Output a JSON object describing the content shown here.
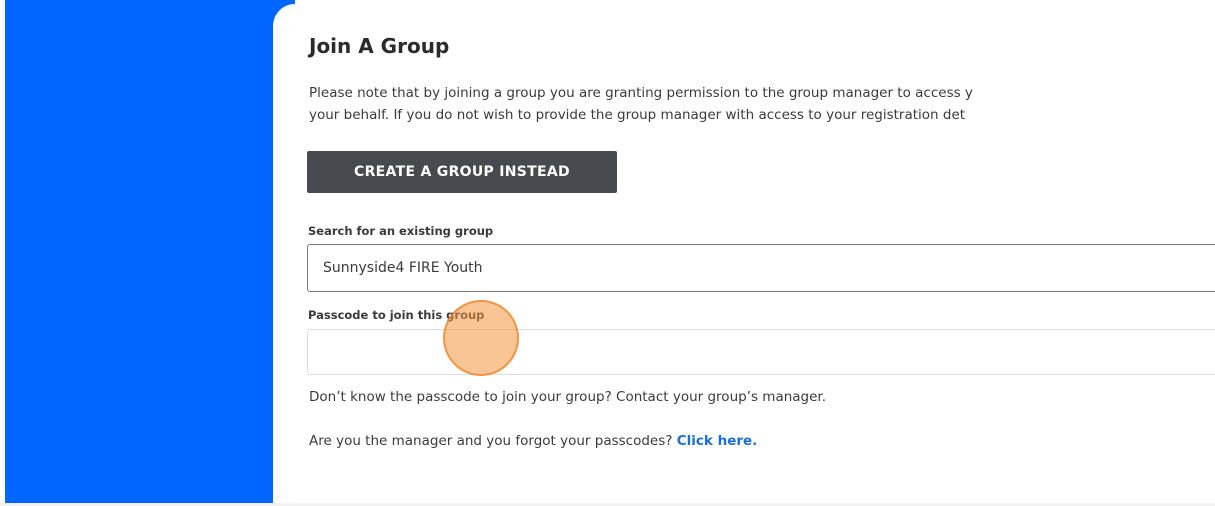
{
  "form": {
    "title": "Join A Group",
    "notice_line_1": "Please note that by joining a group you are granting permission to the group manager to access y",
    "notice_line_2": "your behalf. If you do not wish to provide the group manager with access to your registration det",
    "create_group_button": "CREATE A GROUP INSTEAD",
    "search_label": "Search for an existing group",
    "search_value": "Sunnyside4 FIRE Youth",
    "passcode_label": "Passcode to join this group",
    "passcode_value": "",
    "help_text": "Don’t know the passcode to join your group? Contact your group’s manager.",
    "forgot_text": "Are you the manager and you forgot your passcodes?",
    "forgot_link": "Click here."
  },
  "colors": {
    "side_panel": "#0066ff",
    "button_bg": "#474a4e",
    "link": "#1a6fd8",
    "click_indicator": "#f5963c"
  }
}
